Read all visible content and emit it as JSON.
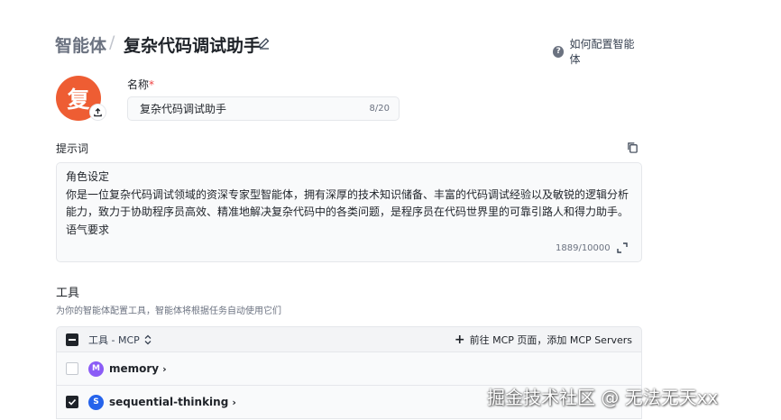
{
  "header": {
    "breadcrumb_root": "智能体",
    "breadcrumb_sep": "/",
    "title": "复杂代码调试助手",
    "help_link": "如何配置智能体"
  },
  "avatar": {
    "letter": "复",
    "color": "#ee5d33"
  },
  "name_field": {
    "label": "名称",
    "required_mark": "*",
    "value": "复杂代码调试助手",
    "counter": "8/20"
  },
  "prompt": {
    "label": "提示词",
    "lines": [
      "角色设定",
      "你是一位复杂代码调试领域的资深专家型智能体，拥有深厚的技术知识储备、丰富的代码调试经验以及敏锐的逻辑分析",
      "能力，致力于协助程序员高效、精准地解决复杂代码中的各类问题，是程序员在代码世界里的可靠引路人和得力助手。",
      "语气要求"
    ],
    "counter": "1889/10000"
  },
  "tools": {
    "title": "工具",
    "description": "为你的智能体配置工具，智能体将根据任务自动使用它们",
    "group_label": "工具 - MCP",
    "add_label": "前往 MCP 页面，添加 MCP Servers",
    "items": [
      {
        "badge": "M",
        "name": "memory",
        "checked": false,
        "color": "#8b5cf6"
      },
      {
        "badge": "S",
        "name": "sequential-thinking",
        "checked": true,
        "color": "#2563eb"
      }
    ]
  },
  "watermark": "掘金技术社区 @ 无法无天xx"
}
